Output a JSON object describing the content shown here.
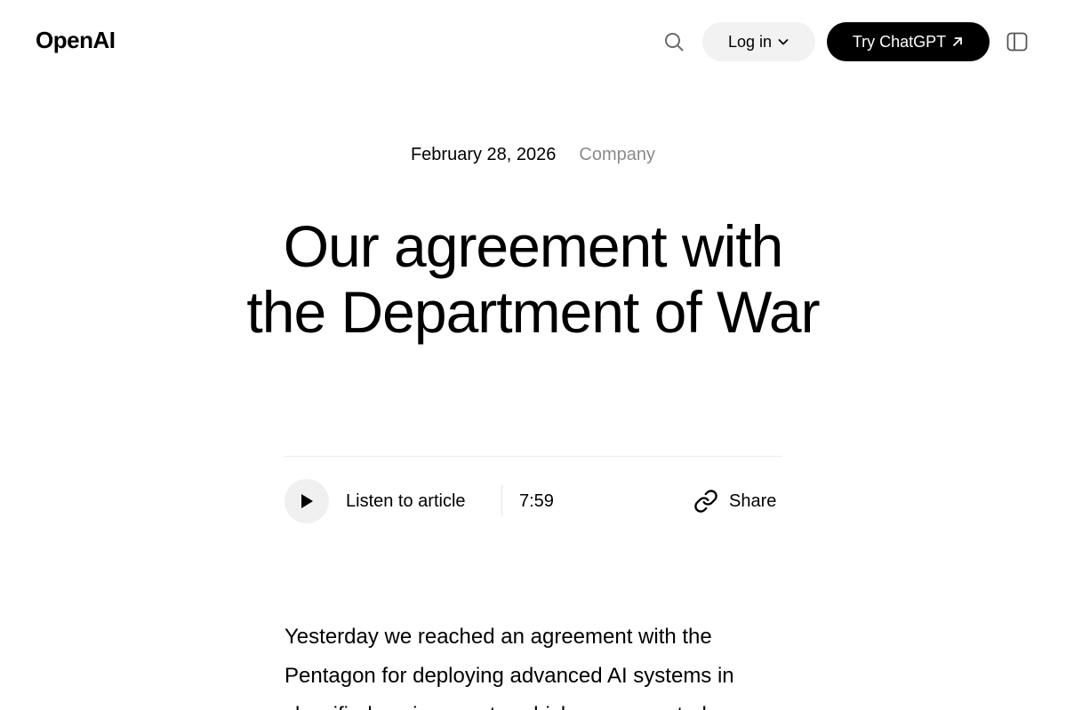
{
  "header": {
    "logo": "OpenAI",
    "login_label": "Log in",
    "cta_label": "Try ChatGPT"
  },
  "icons": {
    "search": "search-icon",
    "login_dropdown": "chevron-down-icon",
    "cta_external": "arrow-up-right-icon",
    "sidebar": "sidebar-toggle-icon",
    "play": "play-icon",
    "share": "link-icon"
  },
  "article": {
    "date": "February 28, 2026",
    "category": "Company",
    "title_line1": "Our agreement with",
    "title_line2": "the Department of War",
    "body_intro": "Yesterday we reached an agreement with the Pentagon for deploying advanced AI systems in classified environments, which we requested"
  },
  "player": {
    "listen_label": "Listen to article",
    "duration": "7:59",
    "share_label": "Share"
  },
  "colors": {
    "background": "#ffffff",
    "text": "#000000",
    "muted": "#8a8a8a",
    "pill_bg": "#f2f2f2",
    "cta_bg": "#000000",
    "cta_text": "#ffffff"
  }
}
